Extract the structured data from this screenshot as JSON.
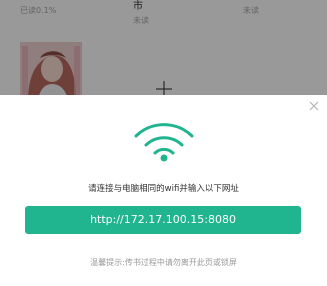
{
  "bookshelf": {
    "books": [
      {
        "title": "",
        "status": "已读0.1%"
      },
      {
        "title": "市",
        "status": "未读"
      },
      {
        "title": "",
        "status": "未读"
      }
    ],
    "cover_icon": "book-cover-portrait",
    "add_icon": "plus-icon"
  },
  "wifi_transfer": {
    "close_icon": "close-icon",
    "wifi_icon": "wifi-icon",
    "instruction": "请连接与电脑相同的wifi并输入以下网址",
    "url": "http://172.17.100.15:8080",
    "tip": "温馨提示:传书过程中请勿离开此页或锁屏",
    "accent_color": "#20b48f"
  }
}
